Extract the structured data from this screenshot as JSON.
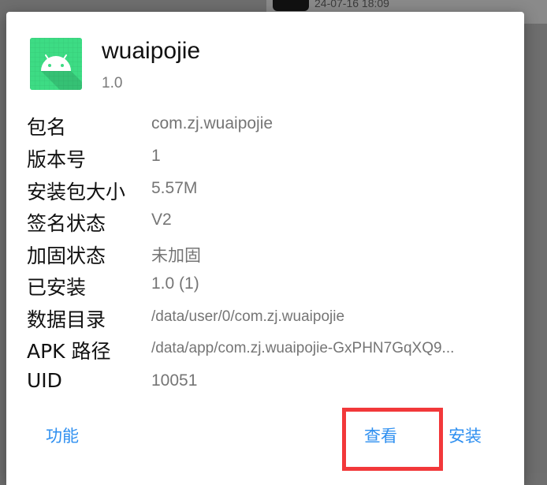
{
  "background": {
    "timestamp": "24-07-16 18:09"
  },
  "app": {
    "name": "wuaipojie",
    "version": "1.0",
    "icon": "android-icon",
    "icon_color": "#3ddc84"
  },
  "info": [
    {
      "key": "包名",
      "value": "com.zj.wuaipojie"
    },
    {
      "key": "版本号",
      "value": "1"
    },
    {
      "key": "安装包大小",
      "value": "5.57M"
    },
    {
      "key": "签名状态",
      "value": "V2"
    },
    {
      "key": "加固状态",
      "value": "未加固"
    },
    {
      "key": "已安装",
      "value": "1.0 (1)"
    },
    {
      "key": "数据目录",
      "value": "/data/user/0/com.zj.wuaipojie"
    },
    {
      "key": "APK 路径",
      "value": "/data/app/com.zj.wuaipojie-GxPHN7GqXQ9..."
    },
    {
      "key": "UID",
      "value": "10051"
    }
  ],
  "actions": {
    "features": "功能",
    "view": "查看",
    "install": "安装"
  },
  "colors": {
    "accent": "#2e8ff0",
    "highlight": "#f2383a"
  }
}
